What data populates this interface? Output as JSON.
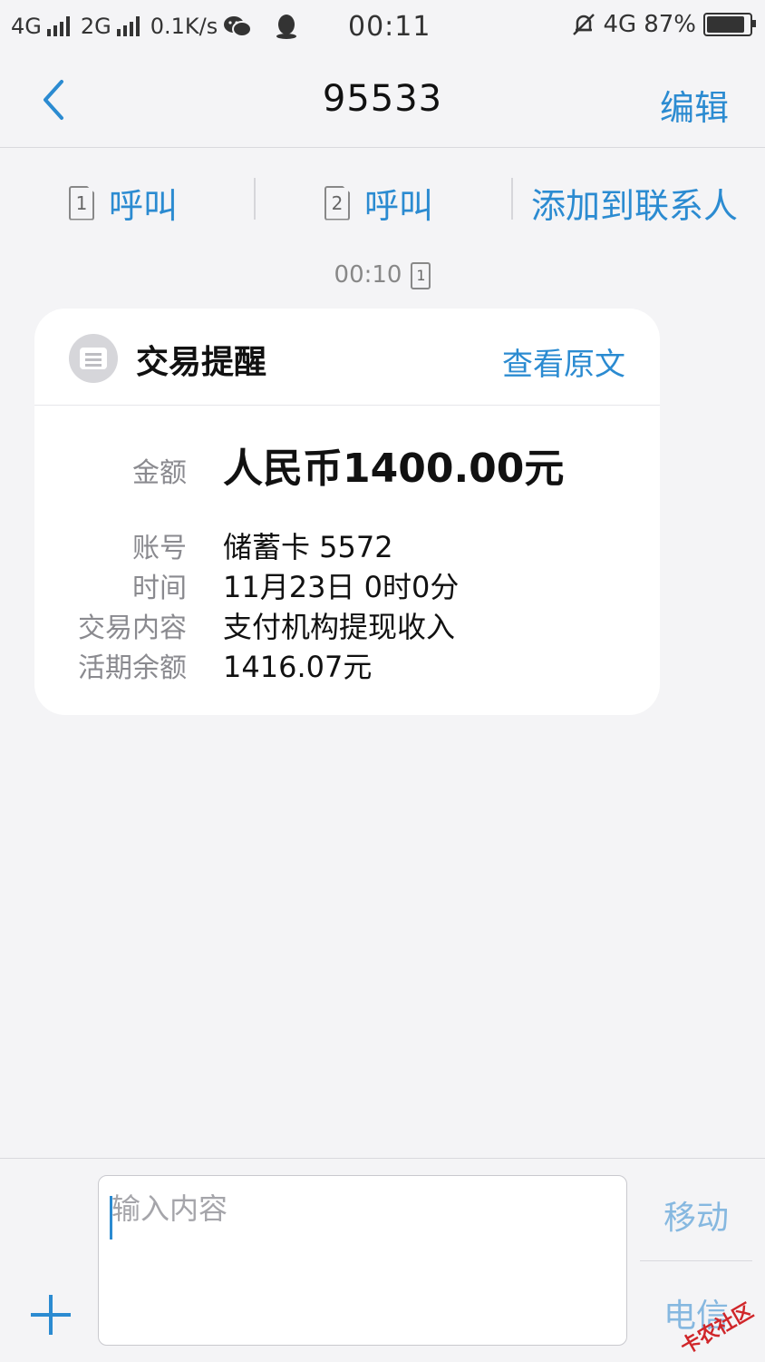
{
  "status_bar": {
    "network1": "4G",
    "network2": "2G",
    "speed": "0.1K/s",
    "time": "00:11",
    "network_right": "4G",
    "battery": "87%"
  },
  "header": {
    "title": "95533",
    "edit": "编辑"
  },
  "actions": {
    "sim1_label": "1",
    "call1": "呼叫",
    "sim2_label": "2",
    "call2": "呼叫",
    "add_contact": "添加到联系人"
  },
  "message": {
    "time": "00:10",
    "sim": "1",
    "card": {
      "title": "交易提醒",
      "view_original": "查看原文",
      "rows": [
        {
          "label": "金额",
          "value": "人民币1400.00元"
        },
        {
          "label": "账号",
          "value": "储蓄卡 5572"
        },
        {
          "label": "时间",
          "value": "11月23日 0时0分"
        },
        {
          "label": "交易内容",
          "value": "支付机构提现收入"
        },
        {
          "label": "活期余额",
          "value": "1416.07元"
        }
      ]
    }
  },
  "compose": {
    "placeholder": "输入内容",
    "send_mobile": "移动",
    "send_telecom": "电信"
  },
  "watermark": "卡农社区"
}
